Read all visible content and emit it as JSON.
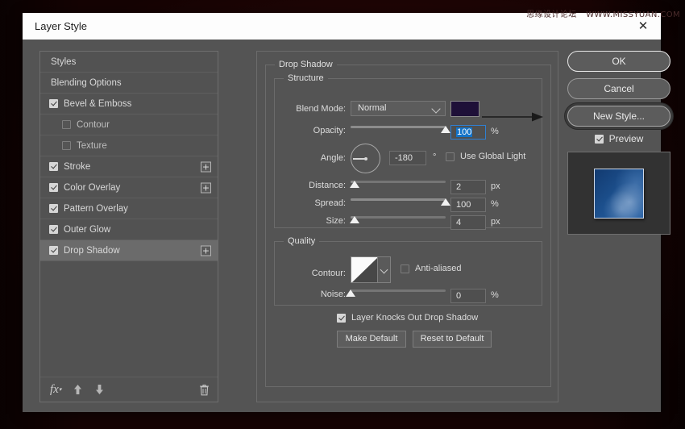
{
  "watermark": {
    "cn": "思缘设计论坛",
    "url": "WWW.MISSYUAN.COM"
  },
  "dialog": {
    "title": "Layer Style",
    "close_icon": "close-icon"
  },
  "styles_list": {
    "items": [
      {
        "label": "Styles",
        "type": "plain",
        "checked": null,
        "plus": false,
        "selected": false
      },
      {
        "label": "Blending Options",
        "type": "plain",
        "checked": null,
        "plus": false,
        "selected": false
      },
      {
        "label": "Bevel & Emboss",
        "type": "check",
        "checked": true,
        "plus": false,
        "selected": false
      },
      {
        "label": "Contour",
        "type": "indent",
        "checked": false,
        "plus": false,
        "selected": false
      },
      {
        "label": "Texture",
        "type": "indent",
        "checked": false,
        "plus": false,
        "selected": false
      },
      {
        "label": "Stroke",
        "type": "check",
        "checked": true,
        "plus": true,
        "selected": false
      },
      {
        "label": "Color Overlay",
        "type": "check",
        "checked": true,
        "plus": true,
        "selected": false
      },
      {
        "label": "Pattern Overlay",
        "type": "check",
        "checked": true,
        "plus": false,
        "selected": false
      },
      {
        "label": "Outer Glow",
        "type": "check",
        "checked": true,
        "plus": false,
        "selected": false
      },
      {
        "label": "Drop Shadow",
        "type": "check",
        "checked": true,
        "plus": true,
        "selected": true
      }
    ],
    "footer": {
      "fx_icon": "fx-icon",
      "up_icon": "move-up-icon",
      "down_icon": "move-down-icon",
      "delete_icon": "trash-icon"
    }
  },
  "panel": {
    "effect_title": "Drop Shadow",
    "structure": {
      "title": "Structure",
      "blend_mode": {
        "label": "Blend Mode:",
        "value": "Normal"
      },
      "shadow_color": "#1e1038",
      "opacity": {
        "label": "Opacity:",
        "value": "100",
        "unit": "%",
        "percent": 100,
        "focused": true
      },
      "angle": {
        "label": "Angle:",
        "value": "-180",
        "unit": "°",
        "degrees": -180
      },
      "use_global_light": {
        "label": "Use Global Light",
        "checked": false
      },
      "distance": {
        "label": "Distance:",
        "value": "2",
        "unit": "px",
        "percent": 4
      },
      "spread": {
        "label": "Spread:",
        "value": "100",
        "unit": "%",
        "percent": 100
      },
      "size": {
        "label": "Size:",
        "value": "4",
        "unit": "px",
        "percent": 4
      }
    },
    "quality": {
      "title": "Quality",
      "contour": {
        "label": "Contour:",
        "preset": "linear"
      },
      "anti_aliased": {
        "label": "Anti-aliased",
        "checked": false
      },
      "noise": {
        "label": "Noise:",
        "value": "0",
        "unit": "%",
        "percent": 0
      }
    },
    "knockout": {
      "label": "Layer Knocks Out Drop Shadow",
      "checked": true
    },
    "make_default": "Make Default",
    "reset_default": "Reset to Default"
  },
  "actions": {
    "ok": "OK",
    "cancel": "Cancel",
    "new_style": "New Style...",
    "preview": {
      "label": "Preview",
      "checked": true
    }
  }
}
